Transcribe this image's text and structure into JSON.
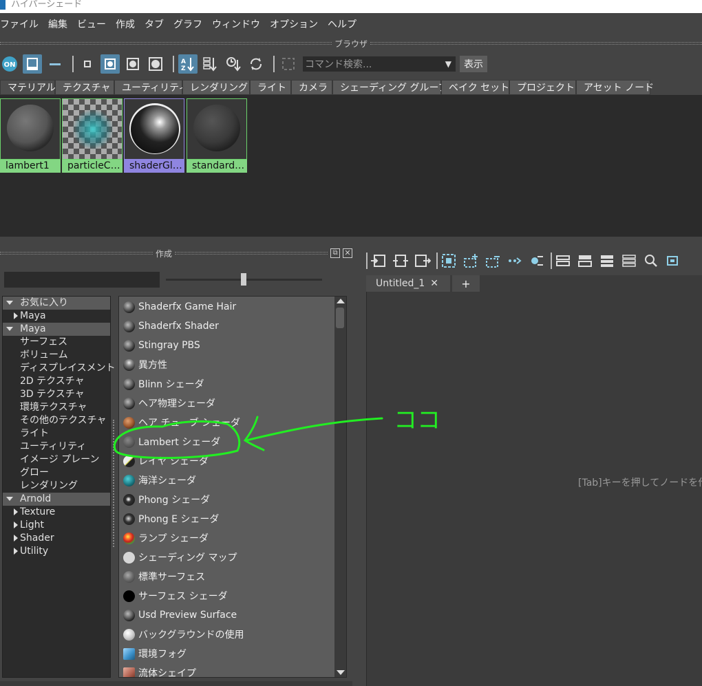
{
  "window": {
    "title": "ハイパーシェード"
  },
  "menu": [
    "ファイル",
    "編集",
    "ビュー",
    "作成",
    "タブ",
    "グラフ",
    "ウィンドウ",
    "オプション",
    "ヘルプ"
  ],
  "browser": {
    "header": "ブラウザ",
    "toolbar": {
      "on_label": "ON",
      "command_search_placeholder": "コマンド検索...",
      "show_button": "表示"
    },
    "tabs": [
      "マテリアル",
      "テクスチャ",
      "ユーティリティ",
      "レンダリング",
      "ライト",
      "カメラ",
      "シェーディング グループ",
      "ベイク セット",
      "プロジェクト",
      "アセット ノード"
    ],
    "swatches": [
      {
        "label": "lambert1",
        "selected": false
      },
      {
        "label": "particleCl…",
        "selected": false
      },
      {
        "label": "shaderGl…",
        "selected": true
      },
      {
        "label": "standard…",
        "selected": false
      }
    ]
  },
  "create": {
    "header": "作成",
    "tree": [
      {
        "label": "お気に入り",
        "level": 0,
        "expanded": true,
        "highlighted": true
      },
      {
        "label": "Maya",
        "level": 1,
        "expanded": false
      },
      {
        "label": "Maya",
        "level": 0,
        "expanded": true,
        "highlighted": true
      },
      {
        "label": "サーフェス",
        "level": 2
      },
      {
        "label": "ボリューム",
        "level": 2
      },
      {
        "label": "ディスプレイスメント",
        "level": 2
      },
      {
        "label": "2D テクスチャ",
        "level": 2
      },
      {
        "label": "3D テクスチャ",
        "level": 2
      },
      {
        "label": "環境テクスチャ",
        "level": 2
      },
      {
        "label": "その他のテクスチャ",
        "level": 2
      },
      {
        "label": "ライト",
        "level": 2
      },
      {
        "label": "ユーティリティ",
        "level": 2
      },
      {
        "label": "イメージ プレーン",
        "level": 2
      },
      {
        "label": "グロー",
        "level": 2
      },
      {
        "label": "レンダリング",
        "level": 2
      },
      {
        "label": "Arnold",
        "level": 0,
        "expanded": true,
        "highlighted": true
      },
      {
        "label": "Texture",
        "level": 1,
        "expanded": false
      },
      {
        "label": "Light",
        "level": 1,
        "expanded": false
      },
      {
        "label": "Shader",
        "level": 1,
        "expanded": false
      },
      {
        "label": "Utility",
        "level": 1,
        "expanded": false
      }
    ],
    "nodes": [
      "Shaderfx Game Hair",
      "Shaderfx Shader",
      "Stingray PBS",
      "異方性",
      "Blinn シェーダ",
      "ヘア物理シェーダ",
      "ヘア チューブ シェーダ",
      "Lambert シェーダ",
      "レイヤ シェーダ",
      "海洋シェーダ",
      "Phong シェーダ",
      "Phong E シェーダ",
      "ランプ シェーダ",
      "シェーディング マップ",
      "標準サーフェス",
      "サーフェス シェーダ",
      "Usd Preview Surface",
      "バックグラウンドの使用",
      "環境フォグ",
      "流体シェイプ"
    ]
  },
  "graph": {
    "tab_label": "Untitled_1",
    "add_tab": "+",
    "hint": "[Tab]キーを押してノードを作成"
  },
  "annotation": {
    "text": "ココ",
    "color": "#22ee22"
  }
}
